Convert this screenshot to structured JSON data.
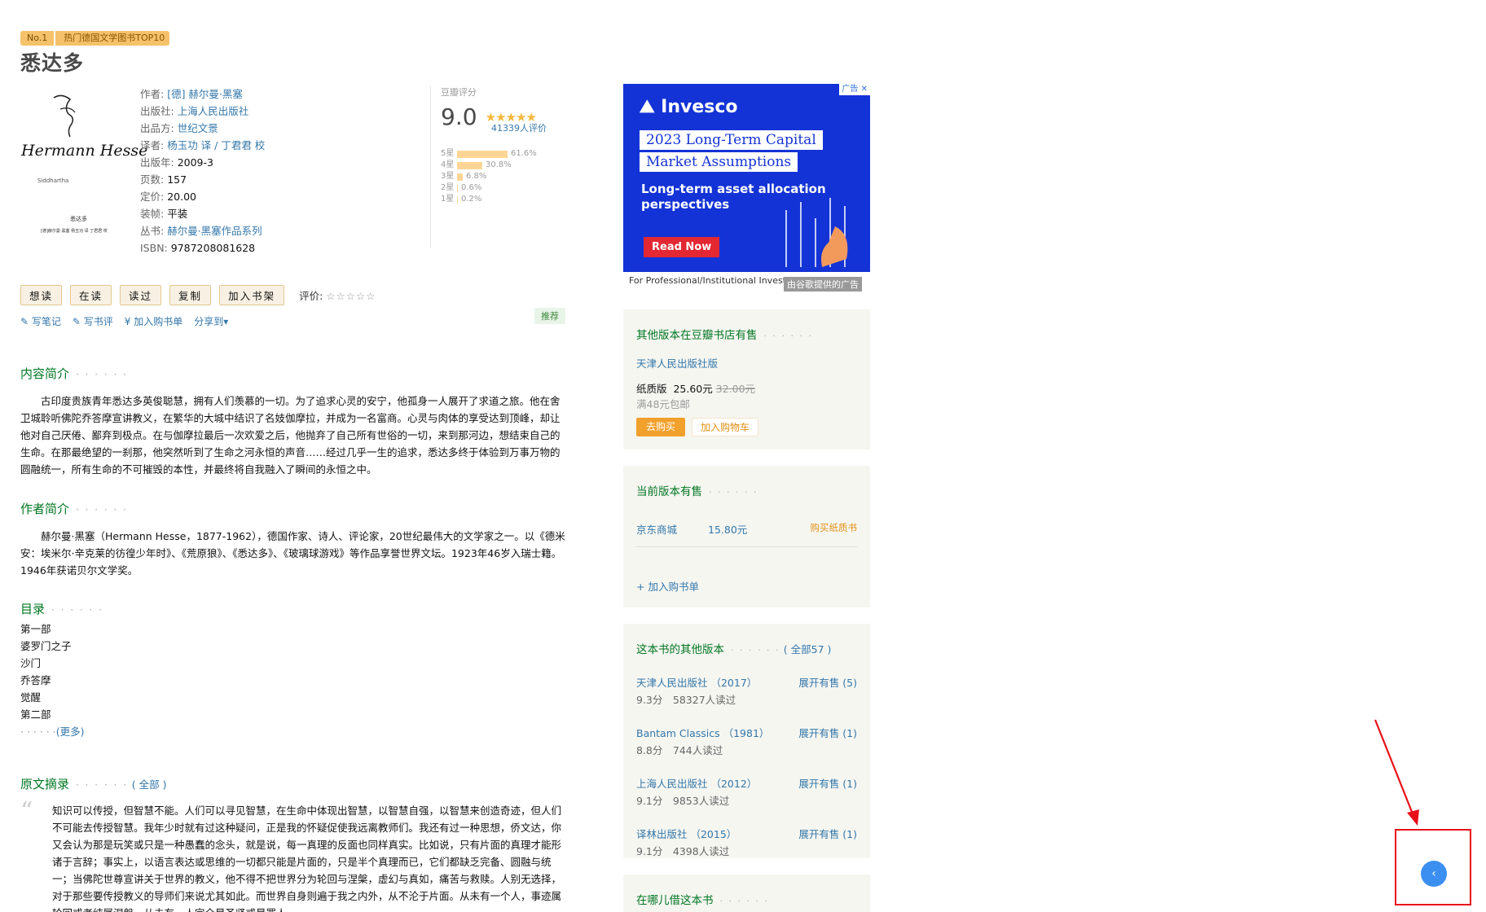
{
  "badge": {
    "rank": "No.1",
    "text": "热门德国文学图书TOP10"
  },
  "book": {
    "title": "悉达多",
    "cover_texts": [
      "Hermann Hesse",
      "Siddhartha",
      "悉达多",
      "[德]赫尔曼·黑塞 杨玉功 译 丁君君 校"
    ],
    "info": {
      "author_label": "作者:",
      "author": "[德] 赫尔曼·黑塞",
      "publisher_label": "出版社:",
      "publisher": "上海人民出版社",
      "producer_label": "出品方:",
      "producer": "世纪文景",
      "translator_label": "译者:",
      "translator": "杨玉功 译 / 丁君君 校",
      "year_label": "出版年:",
      "year": "2009-3",
      "pages_label": "页数:",
      "pages": "157",
      "price_label": "定价:",
      "price": "20.00",
      "binding_label": "装帧:",
      "binding": "平装",
      "series_label": "丛书:",
      "series": "赫尔曼·黑塞作品系列",
      "isbn_label": "ISBN:",
      "isbn": "9787208081628"
    }
  },
  "rating": {
    "label": "豆瓣评分",
    "score": "9.0",
    "stars": "★★★★★",
    "count": "41339人评价",
    "bars": [
      {
        "k": "5星",
        "pct": "61.6%",
        "v": 0.616
      },
      {
        "k": "4星",
        "pct": "30.8%",
        "v": 0.308
      },
      {
        "k": "3星",
        "pct": "6.8%",
        "v": 0.068
      },
      {
        "k": "2星",
        "pct": "0.6%",
        "v": 0.006
      },
      {
        "k": "1星",
        "pct": "0.2%",
        "v": 0.002
      }
    ]
  },
  "actions": {
    "want": "想读",
    "reading": "在读",
    "read": "读过",
    "copy": "复制",
    "add_shelf": "加入书架",
    "eval_label": "评价:",
    "eval_stars": "☆☆☆☆☆"
  },
  "subactions": {
    "note": "✎ 写笔记",
    "review": "✎ 写书评",
    "cart": "¥ 加入购书单",
    "share": "分享到▾",
    "recommend": "推荐"
  },
  "intro": {
    "title": "内容简介",
    "dots": "· · · · · ·",
    "text": "古印度贵族青年悉达多英俊聪慧，拥有人们羡慕的一切。为了追求心灵的安宁，他孤身一人展开了求道之旅。他在舍卫城聆听佛陀乔答摩宣讲教义，在繁华的大城中结识了名妓伽摩拉，并成为一名富商。心灵与肉体的享受达到顶峰，却让他对自己厌倦、鄙弃到极点。在与伽摩拉最后一次欢爱之后，他抛弃了自己所有世俗的一切，来到那河边，想结束自己的生命。在那最绝望的一刹那，他突然听到了生命之河永恒的声音……经过几乎一生的追求，悉达多终于体验到万事万物的圆融统一，所有生命的不可摧毁的本性，并最终将自我融入了瞬间的永恒之中。"
  },
  "author_intro": {
    "title": "作者简介",
    "dots": "· · · · · ·",
    "text": "赫尔曼·黑塞（Hermann Hesse，1877-1962），德国作家、诗人、评论家，20世纪最伟大的文学家之一。以《德米安：埃米尔·辛克莱的彷徨少年时》、《荒原狼》、《悉达多》、《玻璃球游戏》等作品享誉世界文坛。1923年46岁入瑞士籍。1946年获诺贝尔文学奖。"
  },
  "toc": {
    "title": "目录",
    "dots": "· · · · · ·",
    "items": [
      "第一部",
      "婆罗门之子",
      "沙门",
      "乔答摩",
      "觉醒",
      "第二部"
    ],
    "more_prefix": "· · · · · ·",
    "more": "(更多)"
  },
  "excerpt": {
    "title": "原文摘录",
    "dots": "· · · · · ·",
    "all": "( 全部 )",
    "text": "知识可以传授，但智慧不能。人们可以寻见智慧，在生命中体现出智慧，以智慧自强，以智慧来创造奇迹，但人们不可能去传授智慧。我年少时就有过这种疑问，正是我的怀疑促使我远离教师们。我还有过一种思想，侨文达，你又会认为那是玩笑或只是一种愚蠢的念头，就是说，每一真理的反面也同样真实。比如说，只有片面的真理才能形诸于言辞；事实上，以语言表达或思维的一切都只能是片面的，只是半个真理而已，它们都缺乏完备、圆融与统一；当佛陀世尊宣讲关于世界的教义，他不得不把世界分为轮回与涅槃，虚幻与真如，痛苦与救赎。人别无选择，对于那些要传授教义的导师们来说尤其如此。而世界自身则遍于我之内外，从不沦于片面。从未有一个人，事迹属轮回或者纯属涅槃，从未有一人完全是圣贤或是罪人。"
  },
  "ad": {
    "brand": "Invesco",
    "line1": "2023 Long-Term Capital",
    "line2": "Market Assumptions",
    "sub": "Long-term asset allocation perspectives",
    "cta": "Read Now",
    "chip": "广告",
    "footer": "For Professional/Institutional Investors",
    "tag": "由谷歌提供的广告"
  },
  "other_store": {
    "title": "其他版本在豆瓣书店有售",
    "dots": "· · · · · ·",
    "publisher": "天津人民出版社版",
    "format": "纸质版",
    "price": "25.60元",
    "old_price": "32.00元",
    "shipping": "满48元包邮",
    "buy": "去购买",
    "add_cart": "加入购物车"
  },
  "current_sale": {
    "title": "当前版本有售",
    "dots": "· · · · · ·",
    "store": "京东商城",
    "price": "15.80元",
    "buy": "购买纸质书",
    "add_list": "+ 加入购书单"
  },
  "editions": {
    "title": "这本书的其他版本",
    "dots": "· · · · · ·",
    "all": "( 全部57 )",
    "items": [
      {
        "name": "天津人民出版社 （2017）",
        "action": "展开有售 (5)",
        "meta": "9.3分　58327人读过"
      },
      {
        "name": "Bantam Classics （1981）",
        "action": "展开有售 (1)",
        "meta": "8.8分　744人读过"
      },
      {
        "name": "上海人民出版社 （2012）",
        "action": "展开有售 (1)",
        "meta": "9.1分　9853人读过"
      },
      {
        "name": "译林出版社 （2015）",
        "action": "展开有售 (1)",
        "meta": "9.1分　4398人读过"
      }
    ]
  },
  "borrow": {
    "title": "在哪儿借这本书",
    "dots": "· · · · · ·"
  },
  "float_button": {
    "icon": "‹"
  },
  "colors": {
    "accent_green": "#007722",
    "link": "#3377aa",
    "annotation_red": "#e8111a",
    "float_blue": "#3b8ff0"
  }
}
